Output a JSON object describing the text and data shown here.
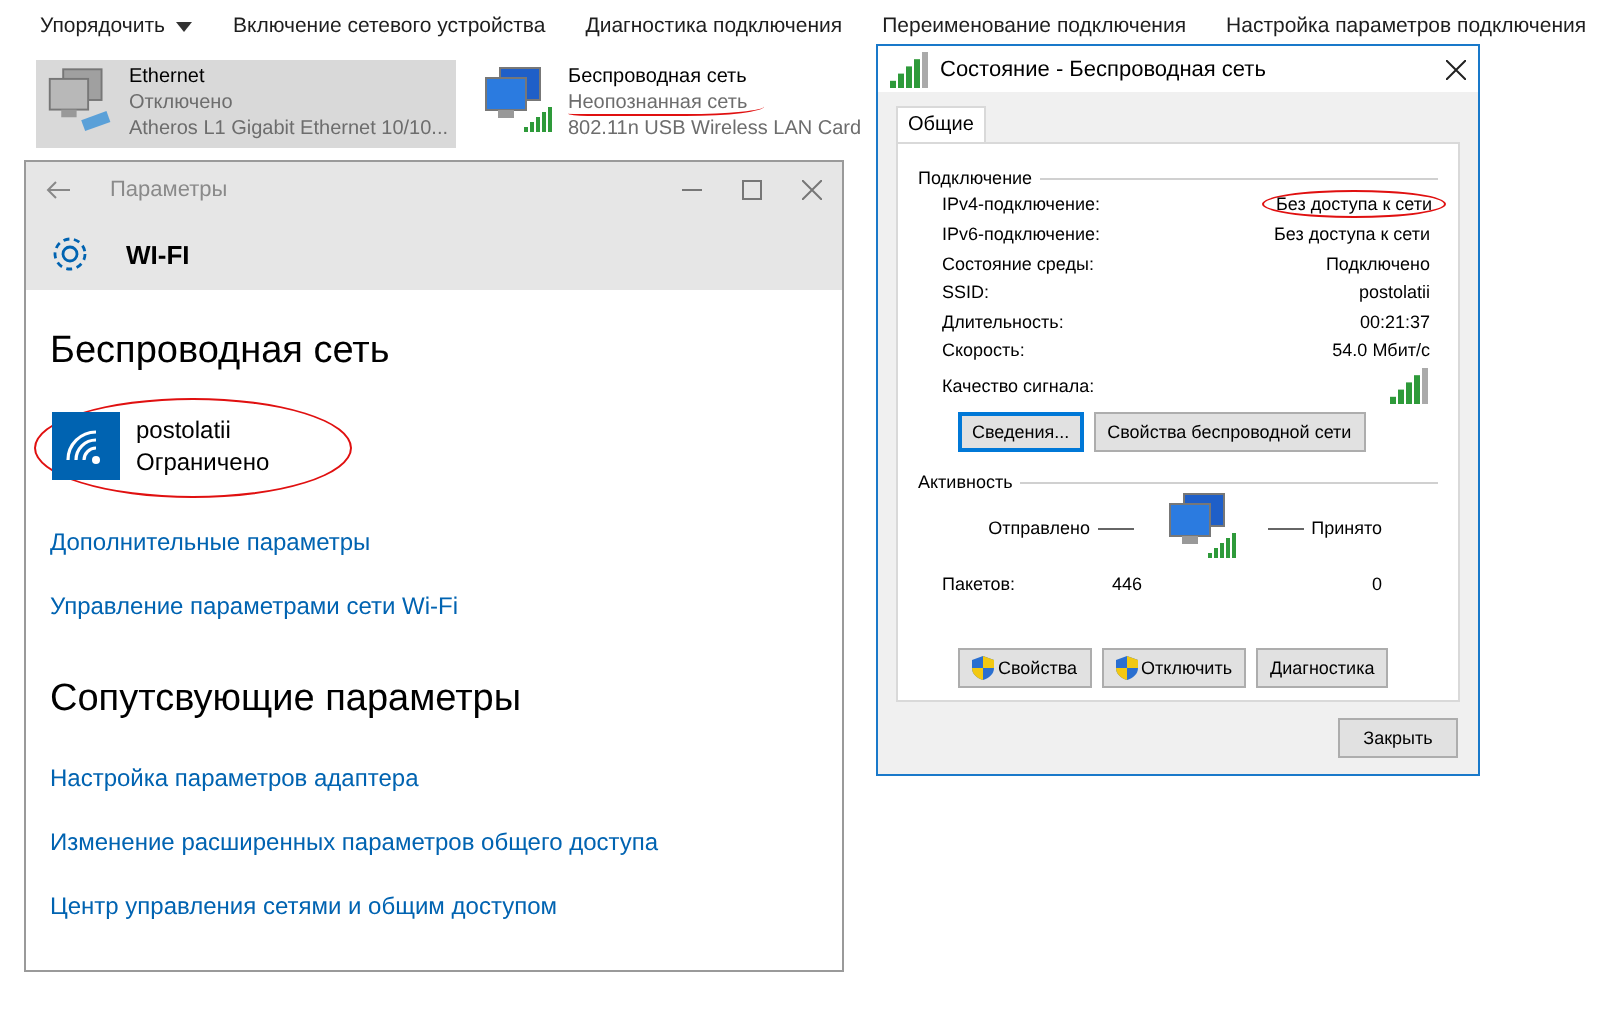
{
  "explorer": {
    "toolbar": [
      {
        "label": "Упорядочить",
        "dropdown": true
      },
      {
        "label": "Включение сетевого устройства",
        "dropdown": false
      },
      {
        "label": "Диагностика подключения",
        "dropdown": false
      },
      {
        "label": "Переименование подключения",
        "dropdown": false
      },
      {
        "label": "Настройка параметров подключения",
        "dropdown": false
      }
    ],
    "connections": [
      {
        "name": "Ethernet",
        "status": "Отключено",
        "adapter": "Atheros L1 Gigabit Ethernet 10/10...",
        "selected": true,
        "kind": "wired"
      },
      {
        "name": "Беспроводная сеть",
        "status": "Неопознанная сеть",
        "adapter": "802.11n USB Wireless LAN Card",
        "selected": false,
        "kind": "wireless"
      }
    ]
  },
  "settings_window": {
    "title": "Параметры",
    "header": "WI-FI",
    "section_title": "Беспроводная сеть",
    "network": {
      "name": "postolatii",
      "status": "Ограничено"
    },
    "links": [
      "Дополнительные параметры",
      "Управление параметрами сети Wi-Fi"
    ],
    "related_title": "Сопутсвующие параметры",
    "related_links": [
      "Настройка параметров адаптера",
      "Изменение расширенных параметров общего доступа",
      "Центр управления сетями и общим доступом"
    ]
  },
  "status_dialog": {
    "title": "Состояние - Беспроводная сеть",
    "tabs": [
      {
        "label": "Общие",
        "selected": true
      }
    ],
    "connection": {
      "title": "Подключение",
      "rows": [
        {
          "label": "IPv4-подключение:",
          "value": "Без доступа к сети"
        },
        {
          "label": "IPv6-подключение:",
          "value": "Без доступа к сети"
        },
        {
          "label": "Состояние среды:",
          "value": "Подключено"
        },
        {
          "label": "SSID:",
          "value": "postolatii"
        },
        {
          "label": "Длительность:",
          "value": "00:21:37"
        },
        {
          "label": "Скорость:",
          "value": "54.0 Мбит/с"
        }
      ],
      "signal_label": "Качество сигнала:",
      "buttons": [
        {
          "label": "Сведения...",
          "focused": true
        },
        {
          "label": "Свойства беспроводной сети",
          "focused": false
        }
      ]
    },
    "activity": {
      "title": "Активность",
      "sent_label": "Отправлено",
      "received_label": "Принято",
      "packets_label": "Пакетов:",
      "sent": "446",
      "received": "0"
    },
    "action_buttons": [
      {
        "label": "Свойства",
        "shield": true
      },
      {
        "label": "Отключить",
        "shield": true
      },
      {
        "label": "Диагностика",
        "shield": false
      }
    ],
    "close_button": "Закрыть"
  }
}
